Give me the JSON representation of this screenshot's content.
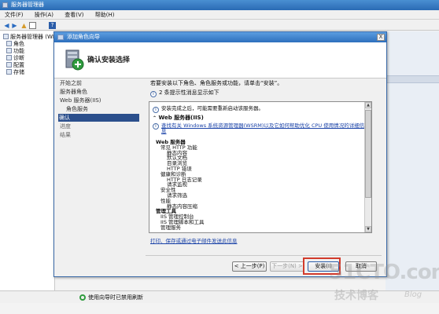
{
  "window": {
    "title": "服务器管理器",
    "menu": [
      "文件(F)",
      "操作(A)",
      "查看(V)",
      "帮助(H)"
    ]
  },
  "tree": {
    "items": [
      "服务器管理器 (WI",
      "角色",
      "功能",
      "诊断",
      "配置",
      "存储"
    ]
  },
  "status": {
    "text": "使用向导时已禁用刷新"
  },
  "wizard": {
    "title": "添加角色向导",
    "header_title": "确认安装选择",
    "close_label": "X",
    "nav": [
      {
        "label": "开始之前",
        "state": "normal"
      },
      {
        "label": "服务器角色",
        "state": "normal"
      },
      {
        "label": "Web 服务器(IIS)",
        "state": "normal"
      },
      {
        "label": "角色服务",
        "state": "sub"
      },
      {
        "label": "确认",
        "state": "active"
      },
      {
        "label": "进度",
        "state": "dim"
      },
      {
        "label": "结果",
        "state": "dim"
      }
    ],
    "intro": "若要安装以下角色、角色服务或功能，请单击“安装”。",
    "info": "2 条提示性消息显示如下",
    "list": {
      "notice": "安装完成之后，可能需要重新启动该服务器。",
      "section": "Web 服务器(IIS)",
      "link": "查找有关 Windows 系统资源管理器(WSRM)以及它如何帮助优化 CPU 使用情况的详细信息",
      "rows": [
        {
          "text": "Web 服务器",
          "bold": true,
          "indent": 0
        },
        {
          "text": "常见 HTTP 功能",
          "bold": false,
          "indent": 1
        },
        {
          "text": "静态内容",
          "bold": false,
          "indent": 2
        },
        {
          "text": "默认文档",
          "bold": false,
          "indent": 2
        },
        {
          "text": "目录浏览",
          "bold": false,
          "indent": 2
        },
        {
          "text": "HTTP 错误",
          "bold": false,
          "indent": 2
        },
        {
          "text": "健康和诊断",
          "bold": false,
          "indent": 1
        },
        {
          "text": "HTTP 日志记录",
          "bold": false,
          "indent": 2
        },
        {
          "text": "请求监视",
          "bold": false,
          "indent": 2
        },
        {
          "text": "安全性",
          "bold": false,
          "indent": 1
        },
        {
          "text": "请求筛选",
          "bold": false,
          "indent": 2
        },
        {
          "text": "性能",
          "bold": false,
          "indent": 1
        },
        {
          "text": "静态内容压缩",
          "bold": false,
          "indent": 2
        },
        {
          "text": "管理工具",
          "bold": true,
          "indent": 0
        },
        {
          "text": "IIS 管理控制台",
          "bold": false,
          "indent": 1
        },
        {
          "text": "IIS 管理脚本和工具",
          "bold": false,
          "indent": 1
        },
        {
          "text": "管理服务",
          "bold": false,
          "indent": 1
        }
      ]
    },
    "print_link": "打印、保存或通过电子邮件发送此信息",
    "buttons": {
      "prev": "< 上一步(P)",
      "next": "下一步(N) >",
      "install": "安装(I)",
      "cancel": "取消"
    }
  },
  "watermark": {
    "main": "51CTO.com",
    "sub": "技术博客",
    "tag": "Blog"
  }
}
